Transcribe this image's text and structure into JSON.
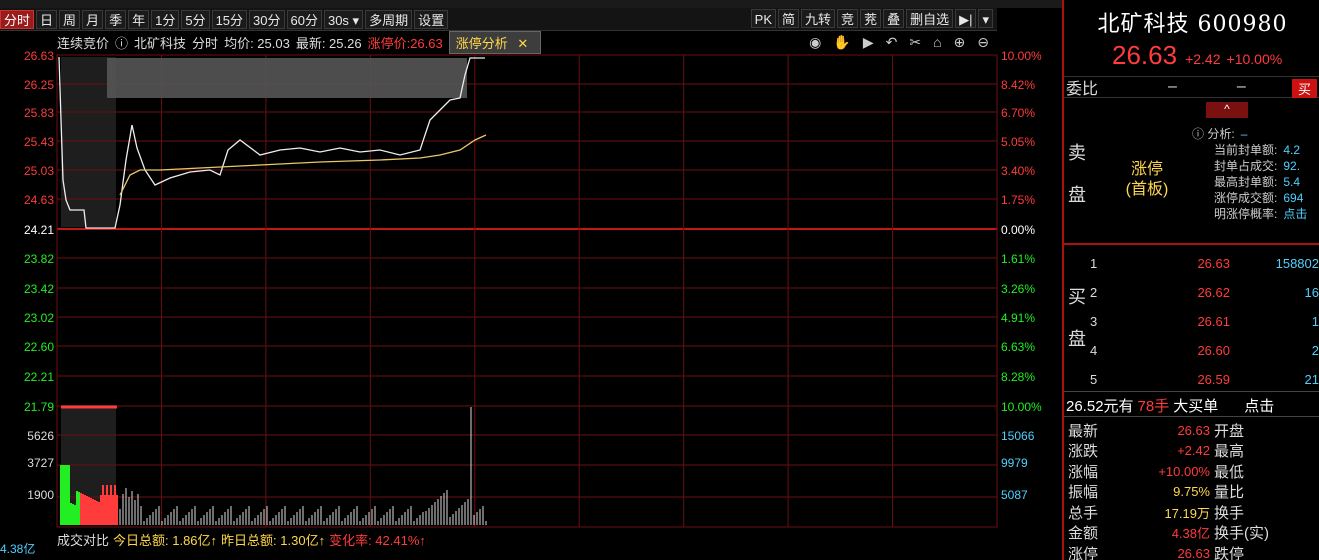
{
  "toolbar": {
    "tabs": [
      "分时",
      "日",
      "周",
      "月",
      "季",
      "年",
      "1分",
      "5分",
      "15分",
      "30分",
      "60分",
      "30s ▾",
      "多周期",
      "设置"
    ],
    "right_buttons": [
      "PK",
      "简",
      "九转",
      "竞",
      "茺",
      "叠",
      "删自选",
      "▶|",
      "▾"
    ]
  },
  "chart_head": {
    "auction": "连续竞价",
    "name": "北矿科技",
    "mode": "分时",
    "avg": "均价: 25.03",
    "last": "最新: 25.26",
    "limit": "涨停价:26.63",
    "tag": "涨停分析"
  },
  "price_axis": {
    "left": [
      "26.63",
      "26.25",
      "25.83",
      "25.43",
      "25.03",
      "24.63",
      "24.21",
      "23.82",
      "23.42",
      "23.02",
      "22.60",
      "22.21",
      "21.79"
    ],
    "right": [
      "10.00%",
      "8.42%",
      "6.70%",
      "5.05%",
      "3.40%",
      "1.75%",
      "0.00%",
      "1.61%",
      "3.26%",
      "4.91%",
      "6.63%",
      "8.28%",
      "10.00%"
    ]
  },
  "volume_axis": {
    "left": [
      "5626",
      "3727",
      "1900"
    ],
    "right": [
      "15066",
      "9979",
      "5087"
    ]
  },
  "colors": {
    "up": "#ff3b3b",
    "down": "#22ee22",
    "flat": "#dddddd",
    "blue": "#4fd0ff",
    "yellow": "#ffd84a",
    "grid": "#6b0f0f"
  },
  "bottom_bar": {
    "label": "成交对比",
    "today": "今日总额: 1.86亿↑",
    "yday": "昨日总额: 1.30亿↑",
    "change": "变化率: 42.41%↑",
    "corner": "4.38亿"
  },
  "side": {
    "title": "北矿科技 600980",
    "price": "26.63",
    "change": "+2.42",
    "pct": "+10.00%",
    "weibi_label": "委比",
    "weibi_val1": "–",
    "weibi_val2": "–",
    "buy_btn": "买",
    "sell_label": [
      "卖",
      "盘"
    ],
    "zt_line1": "涨停",
    "zt_line2": "(首板)",
    "analysis": [
      {
        "k": "分析:",
        "v": "–"
      },
      {
        "k": "当前封单额:",
        "v": "4.2"
      },
      {
        "k": "封单占成交:",
        "v": "92."
      },
      {
        "k": "最高封单额:",
        "v": "5.4"
      },
      {
        "k": "涨停成交额:",
        "v": "694"
      },
      {
        "k": "明涨停概率:",
        "v": "点击"
      }
    ],
    "buy_label": [
      "买",
      "盘"
    ],
    "bids": [
      {
        "lv": "1",
        "price": "26.63",
        "vol": "158802"
      },
      {
        "lv": "2",
        "price": "26.62",
        "vol": "16"
      },
      {
        "lv": "3",
        "price": "26.61",
        "vol": "1"
      },
      {
        "lv": "4",
        "price": "26.60",
        "vol": "2"
      },
      {
        "lv": "5",
        "price": "26.59",
        "vol": "21"
      }
    ],
    "seal": {
      "a": "26.52元有",
      "b": "78手",
      "c": "大买单",
      "d": "点击"
    },
    "stats": [
      {
        "k": "最新",
        "v": "26.63",
        "k2": "开盘"
      },
      {
        "k": "涨跌",
        "v": "+2.42",
        "k2": "最高"
      },
      {
        "k": "涨幅",
        "v": "+10.00%",
        "k2": "最低"
      },
      {
        "k": "振幅",
        "v": "9.75%",
        "k2": "量比"
      },
      {
        "k": "总手",
        "v": "17.19万",
        "k2": "换手"
      },
      {
        "k": "金额",
        "v": "4.38亿",
        "k2": "换手(实)"
      },
      {
        "k": "涨停",
        "v": "26.63",
        "k2": "跌停"
      }
    ]
  }
}
